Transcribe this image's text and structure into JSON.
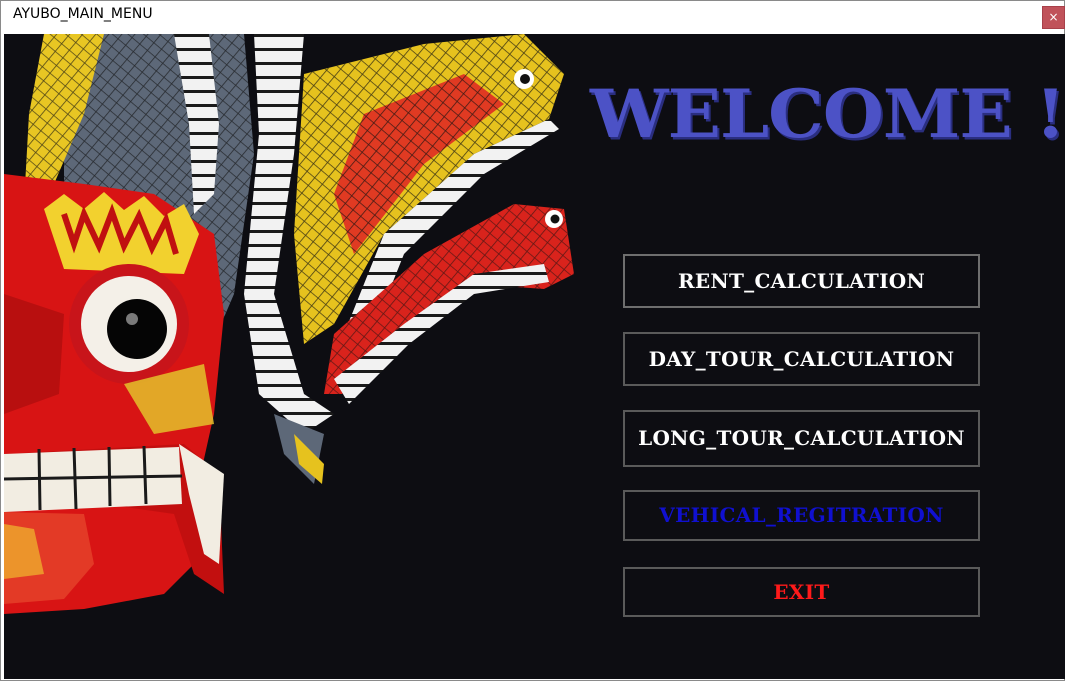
{
  "window": {
    "title": "AYUBO_MAIN_MENU",
    "close_label": "×"
  },
  "main": {
    "welcome_text": "WELCOME !",
    "buttons": {
      "rent": "RENT_CALCULATION",
      "day_tour": "DAY_TOUR_CALCULATION",
      "long_tour": "LONG_TOUR_CALCULATION",
      "vehicle": "VEHICAL_REGITRATION",
      "exit": "EXIT"
    }
  },
  "colors": {
    "background": "#0d0d12",
    "welcome": "#4c52c6",
    "button_text": "#ffffff",
    "vehicle_text": "#1010d0",
    "exit_text": "#ff1a1a",
    "close_button": "#c0525a"
  },
  "images": {
    "banner": "mask-image"
  }
}
